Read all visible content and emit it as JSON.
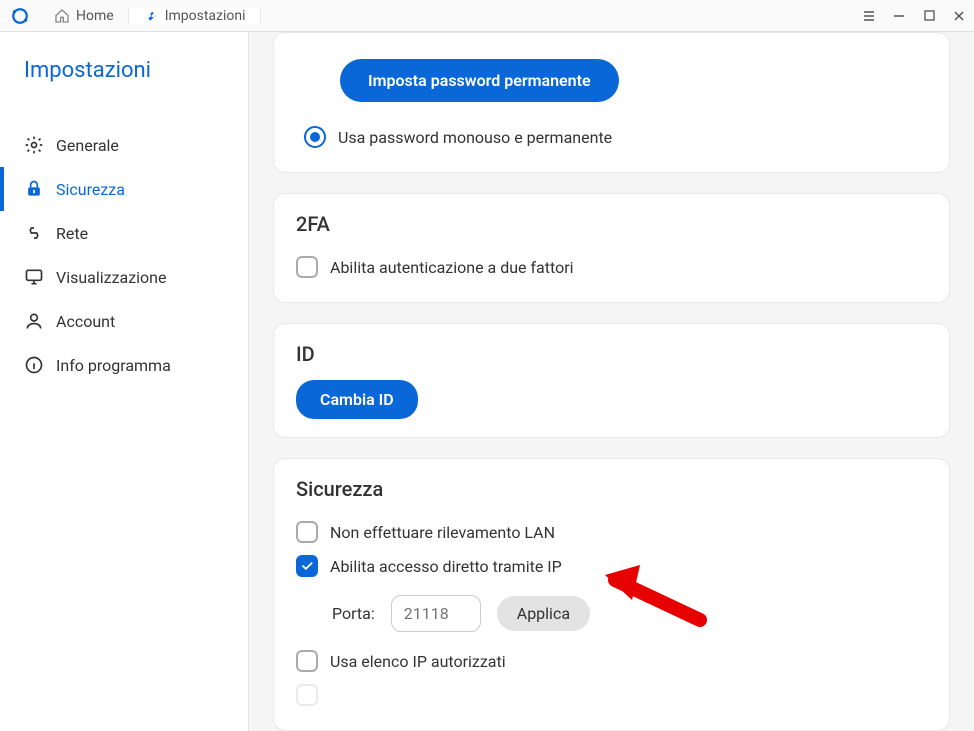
{
  "titlebar": {
    "tabs": {
      "home": "Home",
      "settings": "Impostazioni"
    }
  },
  "sidebar": {
    "title": "Impostazioni",
    "items": [
      {
        "label": "Generale"
      },
      {
        "label": "Sicurezza"
      },
      {
        "label": "Rete"
      },
      {
        "label": "Visualizzazione"
      },
      {
        "label": "Account"
      },
      {
        "label": "Info programma"
      }
    ]
  },
  "password_card": {
    "set_button": "Imposta password permanente",
    "option_both": "Usa password monouso e permanente"
  },
  "twofa_card": {
    "title": "2FA",
    "enable_label": "Abilita autenticazione a due fattori"
  },
  "id_card": {
    "title": "ID",
    "change_button": "Cambia ID"
  },
  "security_card": {
    "title": "Sicurezza",
    "lan_label": "Non effettuare rilevamento LAN",
    "direct_ip_label": "Abilita accesso diretto tramite IP",
    "port_label": "Porta:",
    "port_placeholder": "21118",
    "apply_button": "Applica",
    "whitelist_label": "Usa elenco IP autorizzati"
  }
}
